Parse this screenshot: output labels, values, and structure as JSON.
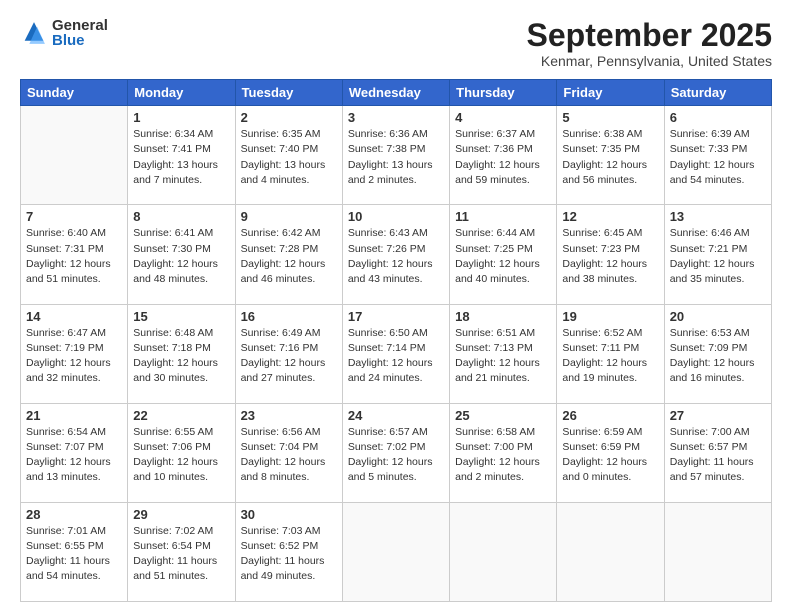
{
  "header": {
    "logo_general": "General",
    "logo_blue": "Blue",
    "month_title": "September 2025",
    "location": "Kenmar, Pennsylvania, United States"
  },
  "days_of_week": [
    "Sunday",
    "Monday",
    "Tuesday",
    "Wednesday",
    "Thursday",
    "Friday",
    "Saturday"
  ],
  "weeks": [
    [
      {
        "day": "",
        "info": []
      },
      {
        "day": "1",
        "info": [
          "Sunrise: 6:34 AM",
          "Sunset: 7:41 PM",
          "Daylight: 13 hours",
          "and 7 minutes."
        ]
      },
      {
        "day": "2",
        "info": [
          "Sunrise: 6:35 AM",
          "Sunset: 7:40 PM",
          "Daylight: 13 hours",
          "and 4 minutes."
        ]
      },
      {
        "day": "3",
        "info": [
          "Sunrise: 6:36 AM",
          "Sunset: 7:38 PM",
          "Daylight: 13 hours",
          "and 2 minutes."
        ]
      },
      {
        "day": "4",
        "info": [
          "Sunrise: 6:37 AM",
          "Sunset: 7:36 PM",
          "Daylight: 12 hours",
          "and 59 minutes."
        ]
      },
      {
        "day": "5",
        "info": [
          "Sunrise: 6:38 AM",
          "Sunset: 7:35 PM",
          "Daylight: 12 hours",
          "and 56 minutes."
        ]
      },
      {
        "day": "6",
        "info": [
          "Sunrise: 6:39 AM",
          "Sunset: 7:33 PM",
          "Daylight: 12 hours",
          "and 54 minutes."
        ]
      }
    ],
    [
      {
        "day": "7",
        "info": [
          "Sunrise: 6:40 AM",
          "Sunset: 7:31 PM",
          "Daylight: 12 hours",
          "and 51 minutes."
        ]
      },
      {
        "day": "8",
        "info": [
          "Sunrise: 6:41 AM",
          "Sunset: 7:30 PM",
          "Daylight: 12 hours",
          "and 48 minutes."
        ]
      },
      {
        "day": "9",
        "info": [
          "Sunrise: 6:42 AM",
          "Sunset: 7:28 PM",
          "Daylight: 12 hours",
          "and 46 minutes."
        ]
      },
      {
        "day": "10",
        "info": [
          "Sunrise: 6:43 AM",
          "Sunset: 7:26 PM",
          "Daylight: 12 hours",
          "and 43 minutes."
        ]
      },
      {
        "day": "11",
        "info": [
          "Sunrise: 6:44 AM",
          "Sunset: 7:25 PM",
          "Daylight: 12 hours",
          "and 40 minutes."
        ]
      },
      {
        "day": "12",
        "info": [
          "Sunrise: 6:45 AM",
          "Sunset: 7:23 PM",
          "Daylight: 12 hours",
          "and 38 minutes."
        ]
      },
      {
        "day": "13",
        "info": [
          "Sunrise: 6:46 AM",
          "Sunset: 7:21 PM",
          "Daylight: 12 hours",
          "and 35 minutes."
        ]
      }
    ],
    [
      {
        "day": "14",
        "info": [
          "Sunrise: 6:47 AM",
          "Sunset: 7:19 PM",
          "Daylight: 12 hours",
          "and 32 minutes."
        ]
      },
      {
        "day": "15",
        "info": [
          "Sunrise: 6:48 AM",
          "Sunset: 7:18 PM",
          "Daylight: 12 hours",
          "and 30 minutes."
        ]
      },
      {
        "day": "16",
        "info": [
          "Sunrise: 6:49 AM",
          "Sunset: 7:16 PM",
          "Daylight: 12 hours",
          "and 27 minutes."
        ]
      },
      {
        "day": "17",
        "info": [
          "Sunrise: 6:50 AM",
          "Sunset: 7:14 PM",
          "Daylight: 12 hours",
          "and 24 minutes."
        ]
      },
      {
        "day": "18",
        "info": [
          "Sunrise: 6:51 AM",
          "Sunset: 7:13 PM",
          "Daylight: 12 hours",
          "and 21 minutes."
        ]
      },
      {
        "day": "19",
        "info": [
          "Sunrise: 6:52 AM",
          "Sunset: 7:11 PM",
          "Daylight: 12 hours",
          "and 19 minutes."
        ]
      },
      {
        "day": "20",
        "info": [
          "Sunrise: 6:53 AM",
          "Sunset: 7:09 PM",
          "Daylight: 12 hours",
          "and 16 minutes."
        ]
      }
    ],
    [
      {
        "day": "21",
        "info": [
          "Sunrise: 6:54 AM",
          "Sunset: 7:07 PM",
          "Daylight: 12 hours",
          "and 13 minutes."
        ]
      },
      {
        "day": "22",
        "info": [
          "Sunrise: 6:55 AM",
          "Sunset: 7:06 PM",
          "Daylight: 12 hours",
          "and 10 minutes."
        ]
      },
      {
        "day": "23",
        "info": [
          "Sunrise: 6:56 AM",
          "Sunset: 7:04 PM",
          "Daylight: 12 hours",
          "and 8 minutes."
        ]
      },
      {
        "day": "24",
        "info": [
          "Sunrise: 6:57 AM",
          "Sunset: 7:02 PM",
          "Daylight: 12 hours",
          "and 5 minutes."
        ]
      },
      {
        "day": "25",
        "info": [
          "Sunrise: 6:58 AM",
          "Sunset: 7:00 PM",
          "Daylight: 12 hours",
          "and 2 minutes."
        ]
      },
      {
        "day": "26",
        "info": [
          "Sunrise: 6:59 AM",
          "Sunset: 6:59 PM",
          "Daylight: 12 hours",
          "and 0 minutes."
        ]
      },
      {
        "day": "27",
        "info": [
          "Sunrise: 7:00 AM",
          "Sunset: 6:57 PM",
          "Daylight: 11 hours",
          "and 57 minutes."
        ]
      }
    ],
    [
      {
        "day": "28",
        "info": [
          "Sunrise: 7:01 AM",
          "Sunset: 6:55 PM",
          "Daylight: 11 hours",
          "and 54 minutes."
        ]
      },
      {
        "day": "29",
        "info": [
          "Sunrise: 7:02 AM",
          "Sunset: 6:54 PM",
          "Daylight: 11 hours",
          "and 51 minutes."
        ]
      },
      {
        "day": "30",
        "info": [
          "Sunrise: 7:03 AM",
          "Sunset: 6:52 PM",
          "Daylight: 11 hours",
          "and 49 minutes."
        ]
      },
      {
        "day": "",
        "info": []
      },
      {
        "day": "",
        "info": []
      },
      {
        "day": "",
        "info": []
      },
      {
        "day": "",
        "info": []
      }
    ]
  ]
}
